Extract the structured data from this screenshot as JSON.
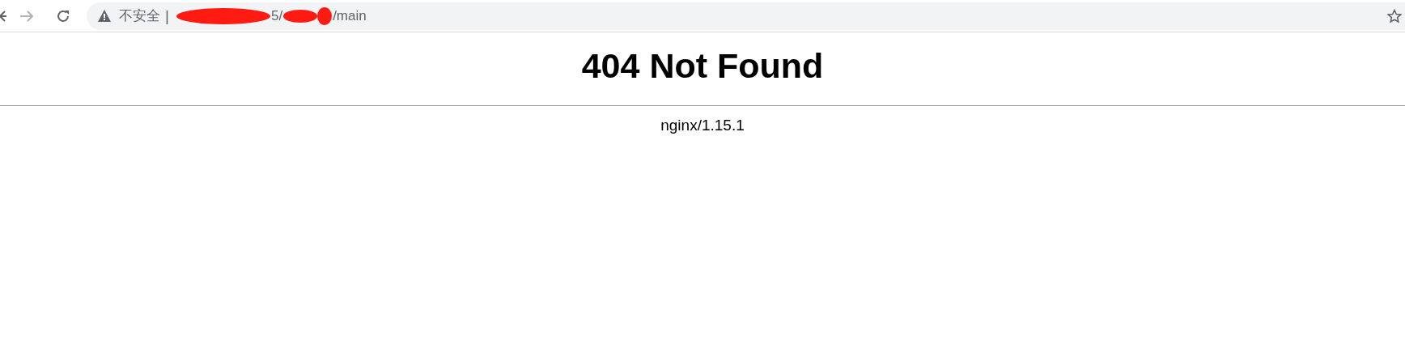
{
  "address_bar": {
    "security_label": "不安全",
    "separator": "|",
    "url_parts": [
      "5/",
      "/main"
    ]
  },
  "page": {
    "heading": "404 Not Found",
    "footer": "nginx/1.15.1"
  }
}
